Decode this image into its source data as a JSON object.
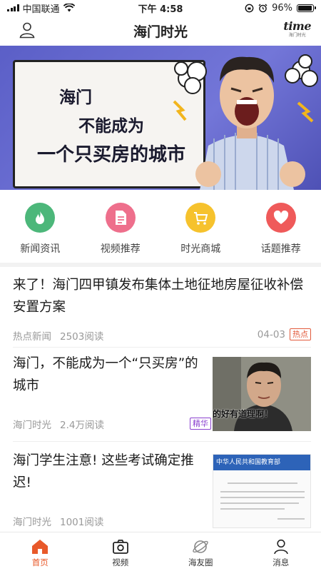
{
  "status_bar": {
    "carrier": "中国联通",
    "time": "下午 4:58",
    "battery": "96%",
    "battery_level": 0.96
  },
  "header": {
    "title": "海门时光",
    "logo_text": "time",
    "logo_sub": "海门时光"
  },
  "banner": {
    "line1": "海门",
    "line2": "不能成为",
    "line3": "一个只买房的城市"
  },
  "quick_menu": [
    {
      "label": "新闻资讯",
      "icon": "flame-icon",
      "color": "#4cb77a"
    },
    {
      "label": "视频推荐",
      "icon": "document-icon",
      "color": "#ee6f8c"
    },
    {
      "label": "时光商城",
      "icon": "cart-icon",
      "color": "#f6c22d"
    },
    {
      "label": "话题推荐",
      "icon": "heart-icon",
      "color": "#ef5a5a"
    }
  ],
  "articles": [
    {
      "title": "来了！海门四甲镇发布集体土地征地房屋征收补偿安置方案",
      "source": "热点新闻",
      "reads": "2503阅读",
      "date": "04-03",
      "tag": "热点"
    },
    {
      "title": "海门，不能成为一个“只买房”的城市",
      "source": "海门时光",
      "reads": "2.4万阅读",
      "tag": "精华",
      "thumb_caption": "的好有道理啊！"
    },
    {
      "title": "海门学生注意! 这些考试确定推迟!",
      "source": "海门时光",
      "reads": "1001阅读",
      "thumb_header": "中华人民共和国教育部"
    }
  ],
  "tabbar": [
    {
      "label": "首页",
      "icon": "home-icon",
      "active": true
    },
    {
      "label": "视频",
      "icon": "camera-icon",
      "active": false
    },
    {
      "label": "海友圈",
      "icon": "planet-icon",
      "active": false
    },
    {
      "label": "消息",
      "icon": "person-icon",
      "active": false
    }
  ],
  "colors": {
    "accent": "#e8592a",
    "banner_bg": "#5b5fc7",
    "tag_hot": "#e25b3c",
    "tag_jing": "#8a3fcf"
  }
}
